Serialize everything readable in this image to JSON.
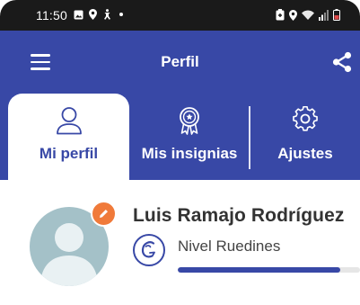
{
  "status_bar": {
    "time": "11:50",
    "left_icons": [
      "image-icon",
      "location-icon",
      "accessibility-icon",
      "dot-icon"
    ],
    "right_icons": [
      "battery-saver-icon",
      "location-icon",
      "wifi-icon",
      "signal-icon",
      "battery-low-icon"
    ]
  },
  "app_bar": {
    "title": "Perfil",
    "menu_icon": "hamburger-menu-icon",
    "share_icon": "share-icon",
    "background_color": "#3848a6"
  },
  "tabs": [
    {
      "label": "Mi perfil",
      "icon": "person-icon",
      "active": true
    },
    {
      "label": "Mis insignias",
      "icon": "badge-icon",
      "active": false
    },
    {
      "label": "Ajustes",
      "icon": "gear-icon",
      "active": false
    }
  ],
  "profile": {
    "name": "Luis Ramajo Rodríguez",
    "level_label": "Nivel Ruedines",
    "level_icon": "ruedines-logo-icon",
    "level_progress": 0.89,
    "edit_badge_color": "#f07a3a",
    "avatar_color": "#a4c1c8"
  }
}
